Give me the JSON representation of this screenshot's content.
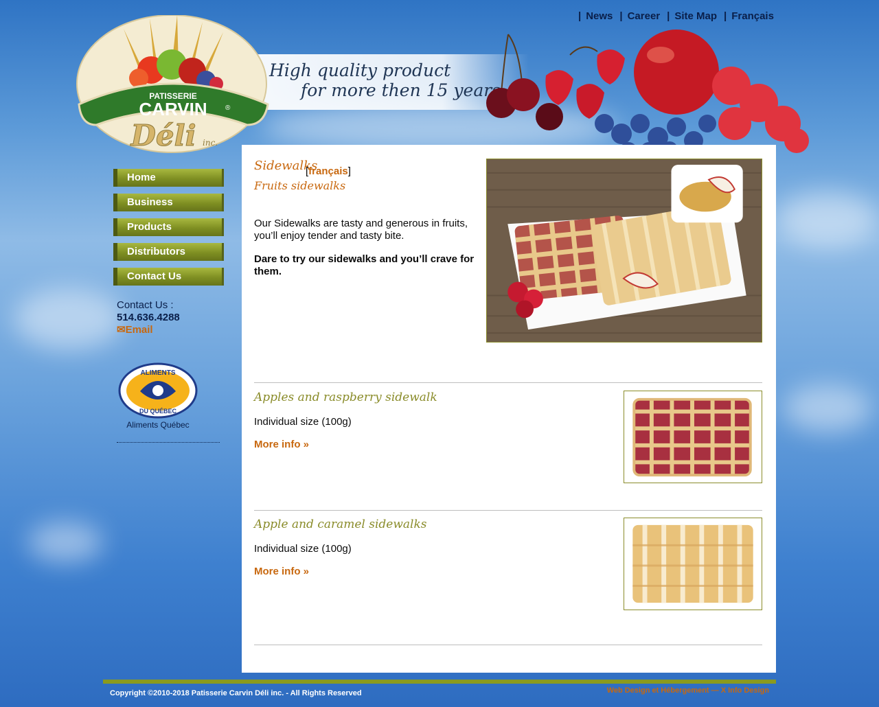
{
  "topnav": {
    "separator": "|",
    "items": [
      {
        "label": "News"
      },
      {
        "label": "Career"
      },
      {
        "label": "Site Map"
      },
      {
        "label": "Français"
      }
    ]
  },
  "logo": {
    "top_text": "PATISSERIE",
    "brand": "CARVIN",
    "script": "Déli",
    "suffix": "inc.",
    "registered": "®"
  },
  "banner": {
    "line1": "High quality product",
    "line2": "for more then 15 years."
  },
  "sidebar": {
    "menu": [
      {
        "label": "Home"
      },
      {
        "label": "Business"
      },
      {
        "label": "Products"
      },
      {
        "label": "Distributors"
      },
      {
        "label": "Contact Us"
      }
    ],
    "contact": {
      "label": "Contact Us :",
      "phone": "514.636.4288",
      "email_icon": "✉",
      "email": "Email"
    },
    "badge": {
      "line1": "ALIMENTS",
      "line2": "DU QUÉBEC",
      "label": "Aliments Québec"
    }
  },
  "content": {
    "title": "Sidewalks",
    "lang_open": "[",
    "lang_link": "français",
    "lang_close": "]",
    "subtitle": "Fruits sidewalks",
    "intro": "Our Sidewalks are tasty and generous in fruits, you’ll enjoy tender and tasty bite.",
    "intro_bold": "Dare to try our sidewalks and you’ll crave for them.",
    "products": [
      {
        "name": "Apples and raspberry sidewalk",
        "size": "Individual size (100g)",
        "more": "More info »"
      },
      {
        "name": "Apple and caramel sidewalks",
        "size": "Individual size (100g)",
        "more": "More info »"
      }
    ]
  },
  "footer": {
    "copyright": "Copyright ©2010-2018 Patisserie Carvin Déli inc. - All Rights Reserved",
    "credit": "Web Design et Hébergement — X Info Design"
  },
  "colors": {
    "sky": "#5c9ad8",
    "menu_green": "#7f8f22",
    "accent_orange": "#c8680f",
    "olive_text": "#8a8c2a",
    "navy_text": "#0a1f4a"
  }
}
